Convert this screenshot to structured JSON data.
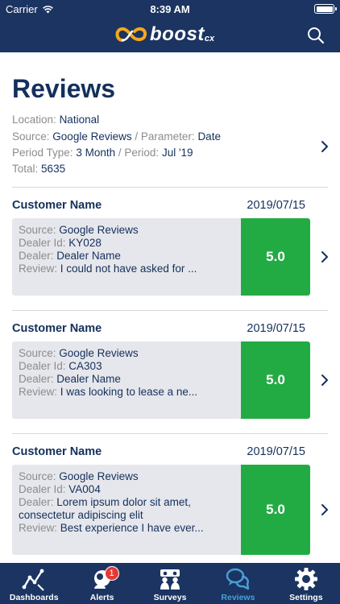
{
  "status_bar": {
    "carrier": "Carrier",
    "time": "8:39 AM"
  },
  "header": {
    "logo_word": "boost",
    "logo_suffix": "cx"
  },
  "page": {
    "title": "Reviews"
  },
  "filters": {
    "location_label": "Location:",
    "location": "National",
    "source_label": "Source:",
    "source": "Google Reviews",
    "separator": "/",
    "parameter_label": "Parameter:",
    "parameter": "Date",
    "period_type_label": "Period Type:",
    "period_type": "3 Month",
    "period_label": "Period:",
    "period": "Jul '19",
    "total_label": "Total:",
    "total": "5635"
  },
  "labels": {
    "source": "Source:",
    "dealer_id": "Dealer Id:",
    "dealer": "Dealer:",
    "review": "Review:"
  },
  "reviews": [
    {
      "customer": "Customer Name",
      "date": "2019/07/15",
      "source": "Google Reviews",
      "dealer_id": "KY028",
      "dealer": "Dealer Name",
      "review": "I could not have asked for ...",
      "score": "5.0"
    },
    {
      "customer": "Customer Name",
      "date": "2019/07/15",
      "source": "Google Reviews",
      "dealer_id": "CA303",
      "dealer": "Dealer Name",
      "review": "I was looking to lease a ne...",
      "score": "5.0"
    },
    {
      "customer": "Customer Name",
      "date": "2019/07/15",
      "source": "Google Reviews",
      "dealer_id": "VA004",
      "dealer_line1": "Lorem ipsum dolor sit amet,",
      "dealer_line2": "consectetur adipiscing elit",
      "review": "Best experience I have ever...",
      "score": "5.0"
    }
  ],
  "tabs": [
    {
      "label": "Dashboards",
      "icon": "chart-line-icon"
    },
    {
      "label": "Alerts",
      "icon": "alert-person-icon",
      "badge": "1"
    },
    {
      "label": "Surveys",
      "icon": "people-icon"
    },
    {
      "label": "Reviews",
      "icon": "chat-bubbles-icon",
      "active": true
    },
    {
      "label": "Settings",
      "icon": "gear-icon"
    }
  ],
  "colors": {
    "header_bg": "#1b3461",
    "text_primary": "#14305c",
    "text_muted": "#8c8c8c",
    "card_bg": "#e6e7ec",
    "score_green": "#23ab43",
    "tab_active": "#4a9fd8",
    "badge_red": "#e53935",
    "logo_gold": "#f2a81d"
  }
}
